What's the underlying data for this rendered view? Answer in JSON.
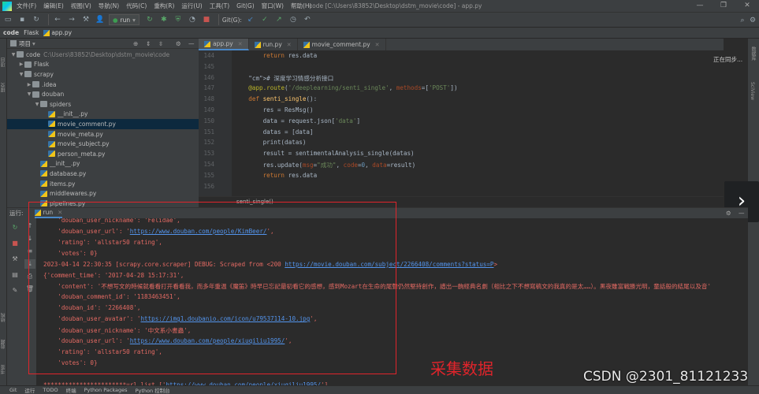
{
  "menubar": {
    "items": [
      "文件(F)",
      "编辑(E)",
      "视图(V)",
      "导航(N)",
      "代码(C)",
      "重构(R)",
      "运行(U)",
      "工具(T)",
      "Git(G)",
      "窗口(W)",
      "帮助(H)"
    ],
    "window_title": "code [C:\\Users\\83852\\Desktop\\dstm_movie\\code] - app.py"
  },
  "toolbar": {
    "run_config": "run",
    "git_label": "Git(G):"
  },
  "breadcrumb": [
    "code",
    "Flask",
    "app.py"
  ],
  "project": {
    "header": "项目",
    "rows": [
      {
        "arrow": "▼",
        "icon": "folder",
        "label": "code",
        "path": "C:\\Users\\83852\\Desktop\\dstm_movie\\code"
      },
      {
        "arrow": "▶",
        "icon": "folder",
        "label": "Flask",
        "path": ""
      },
      {
        "arrow": "▼",
        "icon": "folder",
        "label": "scrapy",
        "path": ""
      },
      {
        "arrow": "▶",
        "icon": "folder",
        "label": ".idea",
        "path": ""
      },
      {
        "arrow": "▼",
        "icon": "folder",
        "label": "douban",
        "path": ""
      },
      {
        "arrow": "▼",
        "icon": "folder",
        "label": "spiders",
        "path": ""
      },
      {
        "arrow": "",
        "icon": "py",
        "label": "__init__.py",
        "path": ""
      },
      {
        "arrow": "",
        "icon": "py",
        "label": "movie_comment.py",
        "path": ""
      },
      {
        "arrow": "",
        "icon": "py",
        "label": "movie_meta.py",
        "path": ""
      },
      {
        "arrow": "",
        "icon": "py",
        "label": "movie_subject.py",
        "path": ""
      },
      {
        "arrow": "",
        "icon": "py",
        "label": "person_meta.py",
        "path": ""
      },
      {
        "arrow": "",
        "icon": "py",
        "label": "__init__.py",
        "path": ""
      },
      {
        "arrow": "",
        "icon": "py",
        "label": "database.py",
        "path": ""
      },
      {
        "arrow": "",
        "icon": "py",
        "label": "items.py",
        "path": ""
      },
      {
        "arrow": "",
        "icon": "py",
        "label": "middlewares.py",
        "path": ""
      },
      {
        "arrow": "",
        "icon": "py",
        "label": "pipelines.py",
        "path": ""
      }
    ]
  },
  "editor": {
    "tabs": [
      "app.py",
      "run.py",
      "movie_comment.py"
    ],
    "line_numbers": [
      "144",
      "145",
      "146",
      "147",
      "148",
      "149",
      "150",
      "151",
      "152",
      "153",
      "154",
      "155",
      "156"
    ],
    "code_lines": [
      "        return res.data",
      "",
      "    # 深度学习情感分析接口",
      "    @app.route('/deeplearning/senti_single', methods=['POST'])",
      "    def senti_single():",
      "        res = ResMsg()",
      "        data = request.json['data']",
      "        datas = [data]",
      "        print(datas)",
      "        result = sentimentalAnalysis_single(datas)",
      "        res.update(msg=\"成功\", code=0, data=result)",
      "        return res.data",
      ""
    ],
    "breadcrumb_fn": "senti_single()",
    "status": "正在同步..."
  },
  "run_panel": {
    "label": "运行:",
    "tab": "run"
  },
  "console": {
    "lines": [
      {
        "t": "    'douban_user_nickname': 'Felidae',"
      },
      {
        "t": "    'douban_user_url': '",
        "link": "https://www.douban.com/people/KimBeer/",
        "after": "',"
      },
      {
        "t": "    'rating': 'allstar50 rating',"
      },
      {
        "t": "    'votes': 0}"
      },
      {
        "t": "2023-04-14 22:30:35 [scrapy.core.scraper] DEBUG: Scraped from <200 ",
        "link": "https://movie.douban.com/subject/2266408/comments?status=P",
        "after": ">"
      },
      {
        "t": "{'comment_time': '2017-04-28 15:17:31',"
      },
      {
        "t": "    'content': '不想写文的時候就看看打开看看我，而多年重温《魔笛》時早已忘記最初看它的感想，感到Mozart在生命的尾聲仍然堅持創作，譜出一齣經典名劇（相比之下不想寫稿文的我真的是太……）。黑夜雖富戰勝光明，童話般的結尾以及音'"
      },
      {
        "t": "    'douban_comment_id': '1183463451',"
      },
      {
        "t": "    'douban_id': '2266408',"
      },
      {
        "t": "    'douban_user_avatar': '",
        "link": "https://img1.doubanio.com/icon/u79537114-10.jpg",
        "after": "',"
      },
      {
        "t": "    'douban_user_nickname': '中文系小書蟲',"
      },
      {
        "t": "    'douban_user_url': '",
        "link": "https://www.douban.com/people/xiuqiliu1995/",
        "after": "',"
      },
      {
        "t": "    'rating': 'allstar50 rating',"
      },
      {
        "t": "    'votes': 0}"
      },
      {
        "t": ""
      },
      {
        "t": "***********************url list ['",
        "link": "https://www.douban.com/people/xiuqiliu1995/",
        "after": "']"
      }
    ]
  },
  "annotation": "采集数据",
  "bottombar": [
    "Git",
    "运行",
    "TODO",
    "终端",
    "Python Packages",
    "Python 控制台"
  ],
  "watermark": "CSDN @2301_81121233",
  "right_strip": [
    "数据库",
    "SciView"
  ],
  "left_strip": [
    "项目",
    "提交",
    "结构",
    "收藏",
    "书签"
  ]
}
